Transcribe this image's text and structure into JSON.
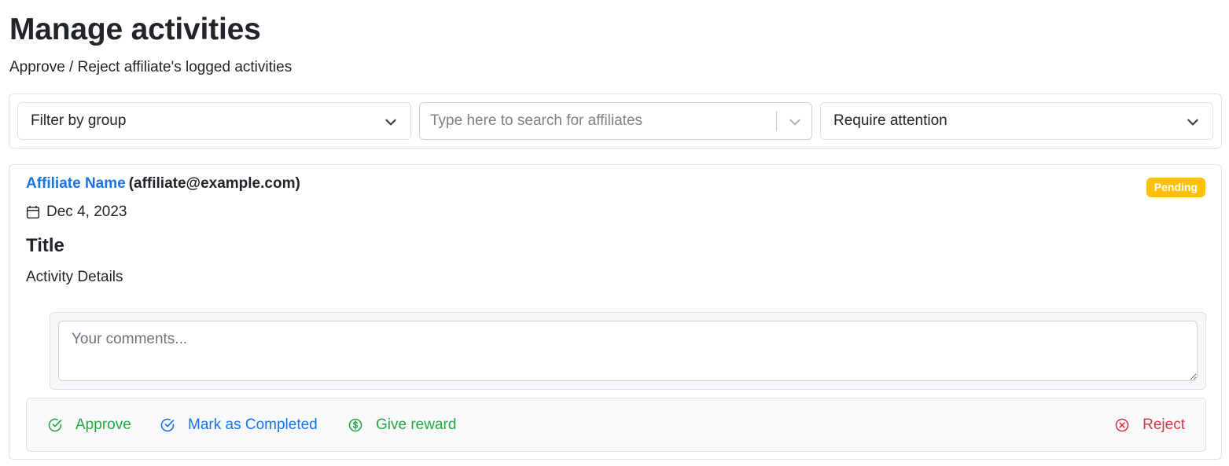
{
  "header": {
    "title": "Manage activities",
    "subtitle": "Approve / Reject affiliate's logged activities"
  },
  "filters": {
    "group": {
      "selected": "Filter by group",
      "icon": "chevron-down-icon"
    },
    "affiliate_search": {
      "placeholder": "Type here to search for affiliates",
      "value": "",
      "icon": "chevron-down-icon"
    },
    "status": {
      "selected": "Require attention",
      "icon": "chevron-down-icon"
    }
  },
  "activity": {
    "affiliate_name": "Affiliate Name",
    "affiliate_email": "(affiliate@example.com)",
    "status": "Pending",
    "date": "Dec 4, 2023",
    "title": "Title",
    "details": "Activity Details",
    "comment_placeholder": "Your comments...",
    "comment_value": ""
  },
  "actions": {
    "approve": "Approve",
    "mark_completed": "Mark as Completed",
    "give_reward": "Give reward",
    "reject": "Reject"
  },
  "colors": {
    "link": "#1a73e8",
    "success": "#28a745",
    "danger": "#dc3545",
    "warning": "#ffc107",
    "border": "#dee2e6"
  }
}
